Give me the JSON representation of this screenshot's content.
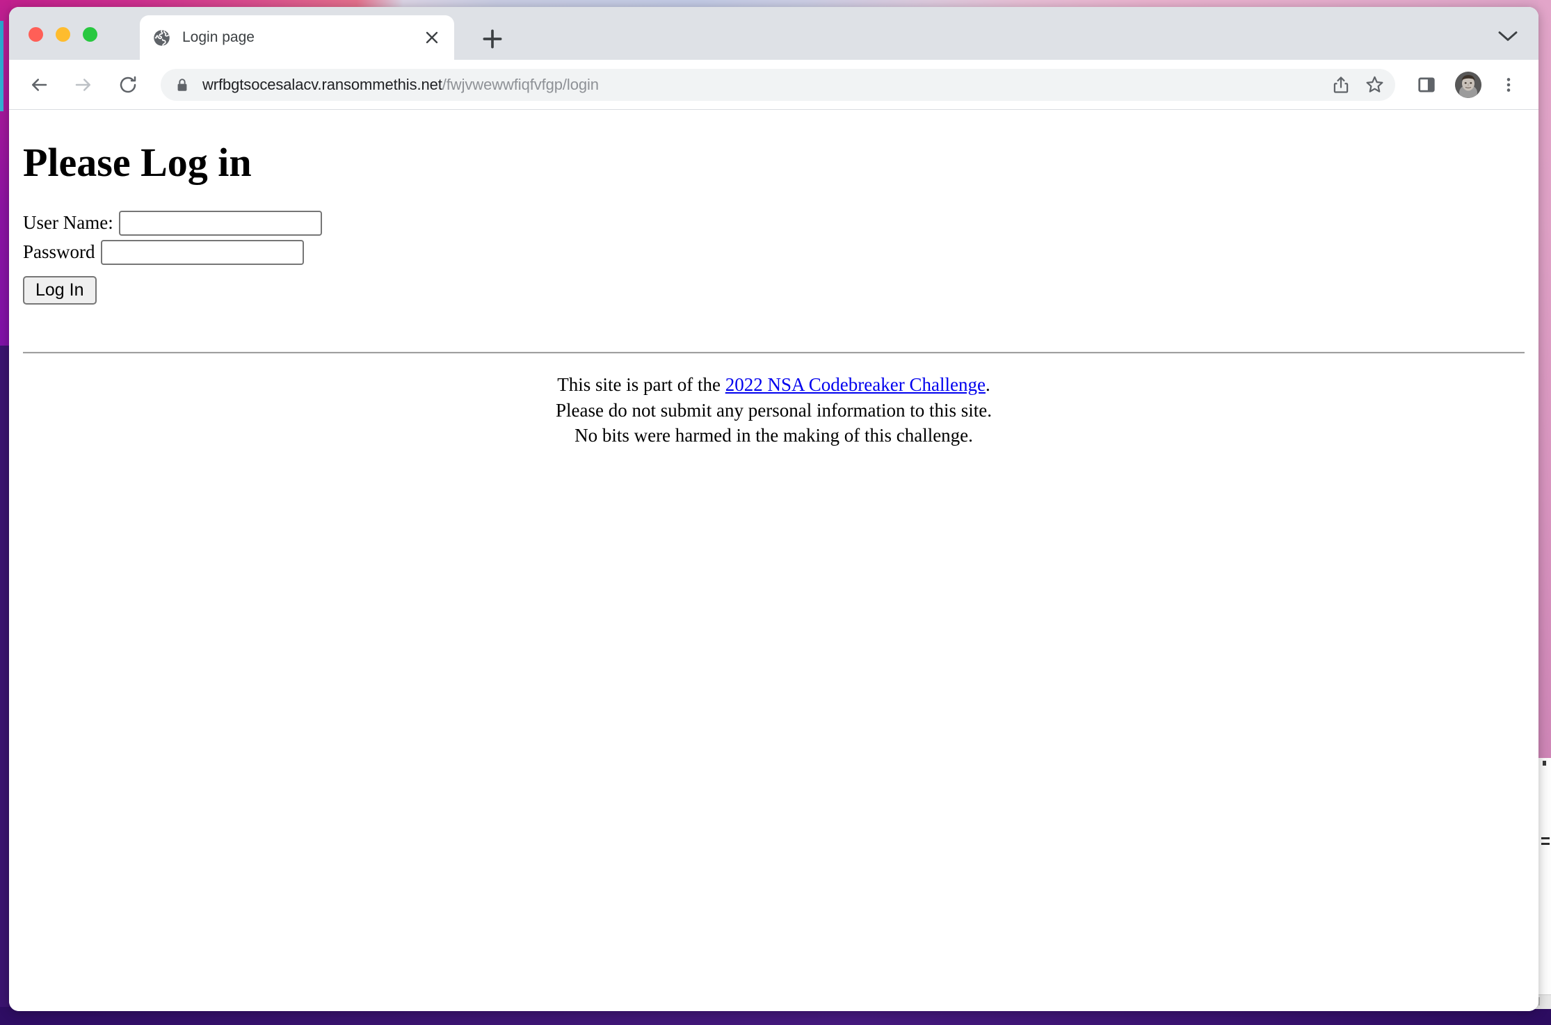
{
  "desktop": {
    "wallpaper_colors": {
      "top_gradient_start": "#c21f8e",
      "top_gradient_mid": "#c3cbe6",
      "top_gradient_end": "#dfa4c8",
      "left_strip": "#8d14a3",
      "left_accent": "#2aa7cf",
      "right_strip": "#dfa1c6",
      "bottom_strip": "#3b1470"
    }
  },
  "window": {
    "traffic_lights": [
      {
        "name": "close",
        "color": "#ff5f57"
      },
      {
        "name": "minimize",
        "color": "#febc2e"
      },
      {
        "name": "zoom",
        "color": "#28c840"
      }
    ]
  },
  "tabstrip": {
    "tabs": [
      {
        "title": "Login page",
        "favicon": "globe-icon",
        "active": true
      }
    ],
    "new_tab_label": "+",
    "close_tab_label": "×",
    "tab_search_icon": "chevron-down-icon"
  },
  "toolbar": {
    "back_icon": "back-arrow-icon",
    "forward_icon": "forward-arrow-icon",
    "reload_icon": "reload-icon",
    "lock_icon": "lock-icon",
    "url": {
      "host": "wrfbgtsocesalacv.ransommethis.net",
      "path": "/fwjvwewwfiqfvfgp/login",
      "full": "wrfbgtsocesalacv.ransommethis.net/fwjvwewwfiqfvfgp/login"
    },
    "share_icon": "share-icon",
    "bookmark_icon": "star-icon",
    "side_panel_icon": "side-panel-icon",
    "avatar_icon": "user-avatar",
    "menu_icon": "three-dot-menu-icon"
  },
  "page": {
    "heading": "Please Log in",
    "form": {
      "username_label": "User Name:",
      "username_value": "",
      "username_placeholder": "",
      "password_label": "Password",
      "password_value": "",
      "password_placeholder": "",
      "submit_label": "Log In"
    },
    "footer": {
      "line1_before": "This site is part of the ",
      "line1_link": "2022 NSA Codebreaker Challenge",
      "line1_after": ".",
      "line2": "Please do not submit any personal information to this site.",
      "line3": "No bits were harmed in the making of this challenge.",
      "link_color": "#0000ee"
    }
  }
}
